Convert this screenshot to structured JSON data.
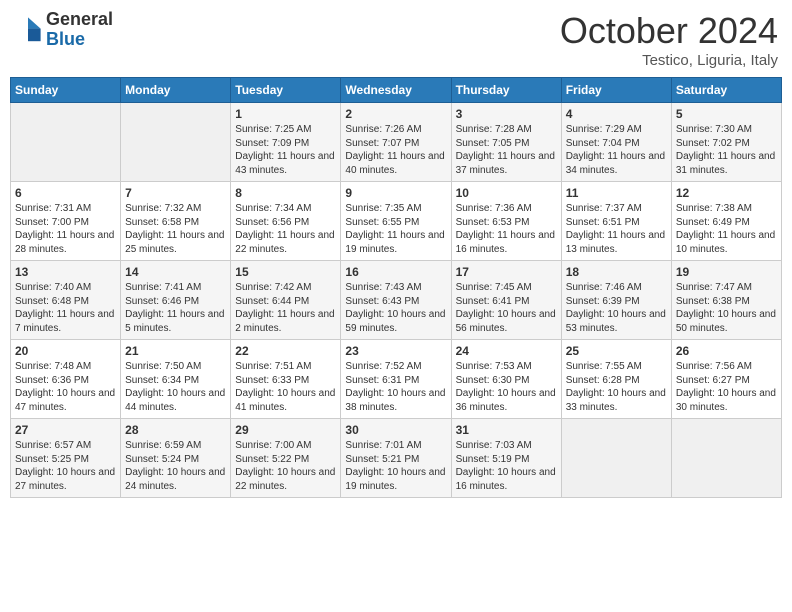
{
  "logo": {
    "general": "General",
    "blue": "Blue"
  },
  "title": "October 2024",
  "subtitle": "Testico, Liguria, Italy",
  "days_of_week": [
    "Sunday",
    "Monday",
    "Tuesday",
    "Wednesday",
    "Thursday",
    "Friday",
    "Saturday"
  ],
  "weeks": [
    [
      {
        "day": "",
        "sunrise": "",
        "sunset": "",
        "daylight": ""
      },
      {
        "day": "",
        "sunrise": "",
        "sunset": "",
        "daylight": ""
      },
      {
        "day": "1",
        "sunrise": "Sunrise: 7:25 AM",
        "sunset": "Sunset: 7:09 PM",
        "daylight": "Daylight: 11 hours and 43 minutes."
      },
      {
        "day": "2",
        "sunrise": "Sunrise: 7:26 AM",
        "sunset": "Sunset: 7:07 PM",
        "daylight": "Daylight: 11 hours and 40 minutes."
      },
      {
        "day": "3",
        "sunrise": "Sunrise: 7:28 AM",
        "sunset": "Sunset: 7:05 PM",
        "daylight": "Daylight: 11 hours and 37 minutes."
      },
      {
        "day": "4",
        "sunrise": "Sunrise: 7:29 AM",
        "sunset": "Sunset: 7:04 PM",
        "daylight": "Daylight: 11 hours and 34 minutes."
      },
      {
        "day": "5",
        "sunrise": "Sunrise: 7:30 AM",
        "sunset": "Sunset: 7:02 PM",
        "daylight": "Daylight: 11 hours and 31 minutes."
      }
    ],
    [
      {
        "day": "6",
        "sunrise": "Sunrise: 7:31 AM",
        "sunset": "Sunset: 7:00 PM",
        "daylight": "Daylight: 11 hours and 28 minutes."
      },
      {
        "day": "7",
        "sunrise": "Sunrise: 7:32 AM",
        "sunset": "Sunset: 6:58 PM",
        "daylight": "Daylight: 11 hours and 25 minutes."
      },
      {
        "day": "8",
        "sunrise": "Sunrise: 7:34 AM",
        "sunset": "Sunset: 6:56 PM",
        "daylight": "Daylight: 11 hours and 22 minutes."
      },
      {
        "day": "9",
        "sunrise": "Sunrise: 7:35 AM",
        "sunset": "Sunset: 6:55 PM",
        "daylight": "Daylight: 11 hours and 19 minutes."
      },
      {
        "day": "10",
        "sunrise": "Sunrise: 7:36 AM",
        "sunset": "Sunset: 6:53 PM",
        "daylight": "Daylight: 11 hours and 16 minutes."
      },
      {
        "day": "11",
        "sunrise": "Sunrise: 7:37 AM",
        "sunset": "Sunset: 6:51 PM",
        "daylight": "Daylight: 11 hours and 13 minutes."
      },
      {
        "day": "12",
        "sunrise": "Sunrise: 7:38 AM",
        "sunset": "Sunset: 6:49 PM",
        "daylight": "Daylight: 11 hours and 10 minutes."
      }
    ],
    [
      {
        "day": "13",
        "sunrise": "Sunrise: 7:40 AM",
        "sunset": "Sunset: 6:48 PM",
        "daylight": "Daylight: 11 hours and 7 minutes."
      },
      {
        "day": "14",
        "sunrise": "Sunrise: 7:41 AM",
        "sunset": "Sunset: 6:46 PM",
        "daylight": "Daylight: 11 hours and 5 minutes."
      },
      {
        "day": "15",
        "sunrise": "Sunrise: 7:42 AM",
        "sunset": "Sunset: 6:44 PM",
        "daylight": "Daylight: 11 hours and 2 minutes."
      },
      {
        "day": "16",
        "sunrise": "Sunrise: 7:43 AM",
        "sunset": "Sunset: 6:43 PM",
        "daylight": "Daylight: 10 hours and 59 minutes."
      },
      {
        "day": "17",
        "sunrise": "Sunrise: 7:45 AM",
        "sunset": "Sunset: 6:41 PM",
        "daylight": "Daylight: 10 hours and 56 minutes."
      },
      {
        "day": "18",
        "sunrise": "Sunrise: 7:46 AM",
        "sunset": "Sunset: 6:39 PM",
        "daylight": "Daylight: 10 hours and 53 minutes."
      },
      {
        "day": "19",
        "sunrise": "Sunrise: 7:47 AM",
        "sunset": "Sunset: 6:38 PM",
        "daylight": "Daylight: 10 hours and 50 minutes."
      }
    ],
    [
      {
        "day": "20",
        "sunrise": "Sunrise: 7:48 AM",
        "sunset": "Sunset: 6:36 PM",
        "daylight": "Daylight: 10 hours and 47 minutes."
      },
      {
        "day": "21",
        "sunrise": "Sunrise: 7:50 AM",
        "sunset": "Sunset: 6:34 PM",
        "daylight": "Daylight: 10 hours and 44 minutes."
      },
      {
        "day": "22",
        "sunrise": "Sunrise: 7:51 AM",
        "sunset": "Sunset: 6:33 PM",
        "daylight": "Daylight: 10 hours and 41 minutes."
      },
      {
        "day": "23",
        "sunrise": "Sunrise: 7:52 AM",
        "sunset": "Sunset: 6:31 PM",
        "daylight": "Daylight: 10 hours and 38 minutes."
      },
      {
        "day": "24",
        "sunrise": "Sunrise: 7:53 AM",
        "sunset": "Sunset: 6:30 PM",
        "daylight": "Daylight: 10 hours and 36 minutes."
      },
      {
        "day": "25",
        "sunrise": "Sunrise: 7:55 AM",
        "sunset": "Sunset: 6:28 PM",
        "daylight": "Daylight: 10 hours and 33 minutes."
      },
      {
        "day": "26",
        "sunrise": "Sunrise: 7:56 AM",
        "sunset": "Sunset: 6:27 PM",
        "daylight": "Daylight: 10 hours and 30 minutes."
      }
    ],
    [
      {
        "day": "27",
        "sunrise": "Sunrise: 6:57 AM",
        "sunset": "Sunset: 5:25 PM",
        "daylight": "Daylight: 10 hours and 27 minutes."
      },
      {
        "day": "28",
        "sunrise": "Sunrise: 6:59 AM",
        "sunset": "Sunset: 5:24 PM",
        "daylight": "Daylight: 10 hours and 24 minutes."
      },
      {
        "day": "29",
        "sunrise": "Sunrise: 7:00 AM",
        "sunset": "Sunset: 5:22 PM",
        "daylight": "Daylight: 10 hours and 22 minutes."
      },
      {
        "day": "30",
        "sunrise": "Sunrise: 7:01 AM",
        "sunset": "Sunset: 5:21 PM",
        "daylight": "Daylight: 10 hours and 19 minutes."
      },
      {
        "day": "31",
        "sunrise": "Sunrise: 7:03 AM",
        "sunset": "Sunset: 5:19 PM",
        "daylight": "Daylight: 10 hours and 16 minutes."
      },
      {
        "day": "",
        "sunrise": "",
        "sunset": "",
        "daylight": ""
      },
      {
        "day": "",
        "sunrise": "",
        "sunset": "",
        "daylight": ""
      }
    ]
  ]
}
